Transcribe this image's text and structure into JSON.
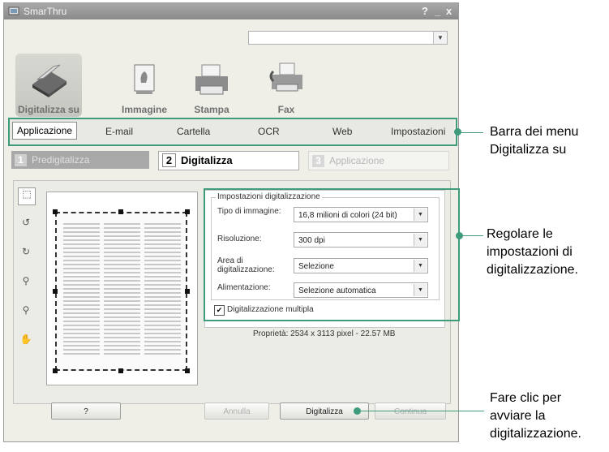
{
  "window": {
    "title": "SmarThru",
    "help_icon": "?",
    "min_icon": "_",
    "close_icon": "x"
  },
  "toolbar": {
    "items": [
      {
        "label": "Digitalizza su",
        "icon": "scanner-icon"
      },
      {
        "label": "Immagine",
        "icon": "image-icon"
      },
      {
        "label": "Stampa",
        "icon": "printer-icon"
      },
      {
        "label": "Fax",
        "icon": "fax-icon"
      }
    ]
  },
  "menubar": {
    "items": [
      "Applicazione",
      "E-mail",
      "Cartella",
      "OCR",
      "Web",
      "Impostazioni"
    ]
  },
  "steps": [
    {
      "num": "1",
      "label": "Predigitalizza"
    },
    {
      "num": "2",
      "label": "Digitalizza"
    },
    {
      "num": "3",
      "label": "Applicazione"
    }
  ],
  "settings": {
    "group_title": "Impostazioni digitalizzazione",
    "fields": [
      {
        "label": "Tipo di immagine:",
        "value": "16,8 milioni di colori (24 bit)"
      },
      {
        "label": "Risoluzione:",
        "value": "300 dpi"
      },
      {
        "label": "Area di digitalizzazione:",
        "value": "Selezione"
      },
      {
        "label": "Alimentazione:",
        "value": "Selezione automatica"
      }
    ],
    "checkbox_label": "Digitalizzazione multipla",
    "checkbox_checked": true,
    "properties": "Proprietà: 2534 x 3113 pixel - 22.57 MB"
  },
  "buttons": {
    "help": "?",
    "cancel": "Annulla",
    "scan": "Digitalizza",
    "continue": "Continua"
  },
  "callouts": {
    "menubar": [
      "Barra dei menu",
      "Digitalizza su"
    ],
    "settings": [
      "Regolare le",
      "impostazioni di",
      "digitalizzazione."
    ],
    "scan": [
      "Fare clic per",
      "avviare la",
      "digitalizzazione."
    ]
  },
  "colors": {
    "callout": "#3e9c7c",
    "titlebar": "#8a8a8a",
    "window_bg": "#efefe8"
  }
}
